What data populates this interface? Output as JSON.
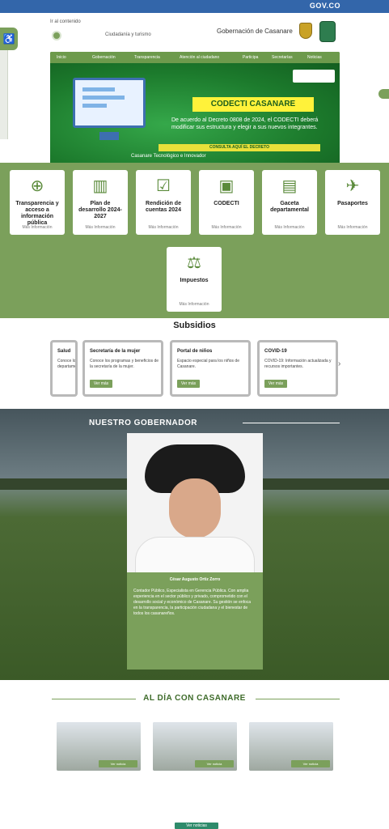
{
  "topbar": {
    "label": "GOV.CO"
  },
  "header": {
    "small_link": "Ir al contenido",
    "search_text": "Ciudadanía y turismo",
    "brand": "Gobernación de Casanare"
  },
  "banner": {
    "title": "CODECTI CASANARE",
    "description": "De acuerdo al Decreto 0808 de 2024, el CODECTI deberá modificar sus estructura y elegir a sus nuevos integrantes.",
    "strip": "CONSULTA AQUÍ EL DECRETO",
    "cta": "Casanare Tecnológico e Innovador",
    "nav": [
      "Inicio",
      "Gobernación",
      "Transparencia",
      "Atención al ciudadano",
      "Participa",
      "Secretarías",
      "Noticias"
    ]
  },
  "services": [
    {
      "label": "Pasaportes",
      "more": "Más Información",
      "icon": "airplane-icon"
    },
    {
      "label": "Gaceta departamental",
      "more": "Más Información",
      "icon": "book-icon"
    },
    {
      "label": "CODECTI",
      "more": "Más Información",
      "icon": "chip-icon"
    },
    {
      "label": "Rendición de cuentas 2024",
      "more": "Más Información",
      "icon": "check-doc-icon"
    },
    {
      "label": "Plan de desarrollo 2024-2027",
      "more": "Más Información",
      "icon": "notebook-icon"
    },
    {
      "label": "Transparencia y acceso a información pública",
      "more": "Más Información",
      "icon": "magnifier-plus-icon"
    },
    {
      "label": "Impuestos",
      "more": "Más Información",
      "icon": "scales-icon"
    }
  ],
  "subsidies": {
    "title": "Subsidios",
    "cards": [
      {
        "title": "COVID-19",
        "desc": "COVID-19: Información actualizada y recursos importantes.",
        "button": "Ver más"
      },
      {
        "title": "Portal de niños",
        "desc": "Espacio especial para los niños de Casanare.",
        "button": "Ver más"
      },
      {
        "title": "Secretaría de la mujer",
        "desc": "Conoce los programas y beneficios de la secretaría de la mujer.",
        "button": "Ver más"
      },
      {
        "title": "Salud",
        "desc": "Conoce los servicios de salud del departamento.",
        "button": "Ver más"
      }
    ]
  },
  "governor": {
    "section_title": "NUESTRO GOBERNADOR",
    "name": "César Augusto Ortiz Zorro",
    "bio": "Contador Público, Especialista en Gerencia Pública. Con amplia experiencia en el sector público y privado, comprometido con el desarrollo social y económico de Casanare. Su gestión se enfoca en la transparencia, la participación ciudadana y el bienestar de todos los casanareños."
  },
  "news": {
    "title": "AL DÍA CON CASANARE",
    "items": [
      {
        "tag": "Ver noticia"
      },
      {
        "tag": "Ver noticia"
      },
      {
        "tag": "Ver noticia"
      }
    ],
    "more_button": "Ver noticias"
  },
  "colors": {
    "brand_green": "#7ba05b",
    "topbar_blue": "#3366aa",
    "dark_green": "#1d7a2d"
  }
}
